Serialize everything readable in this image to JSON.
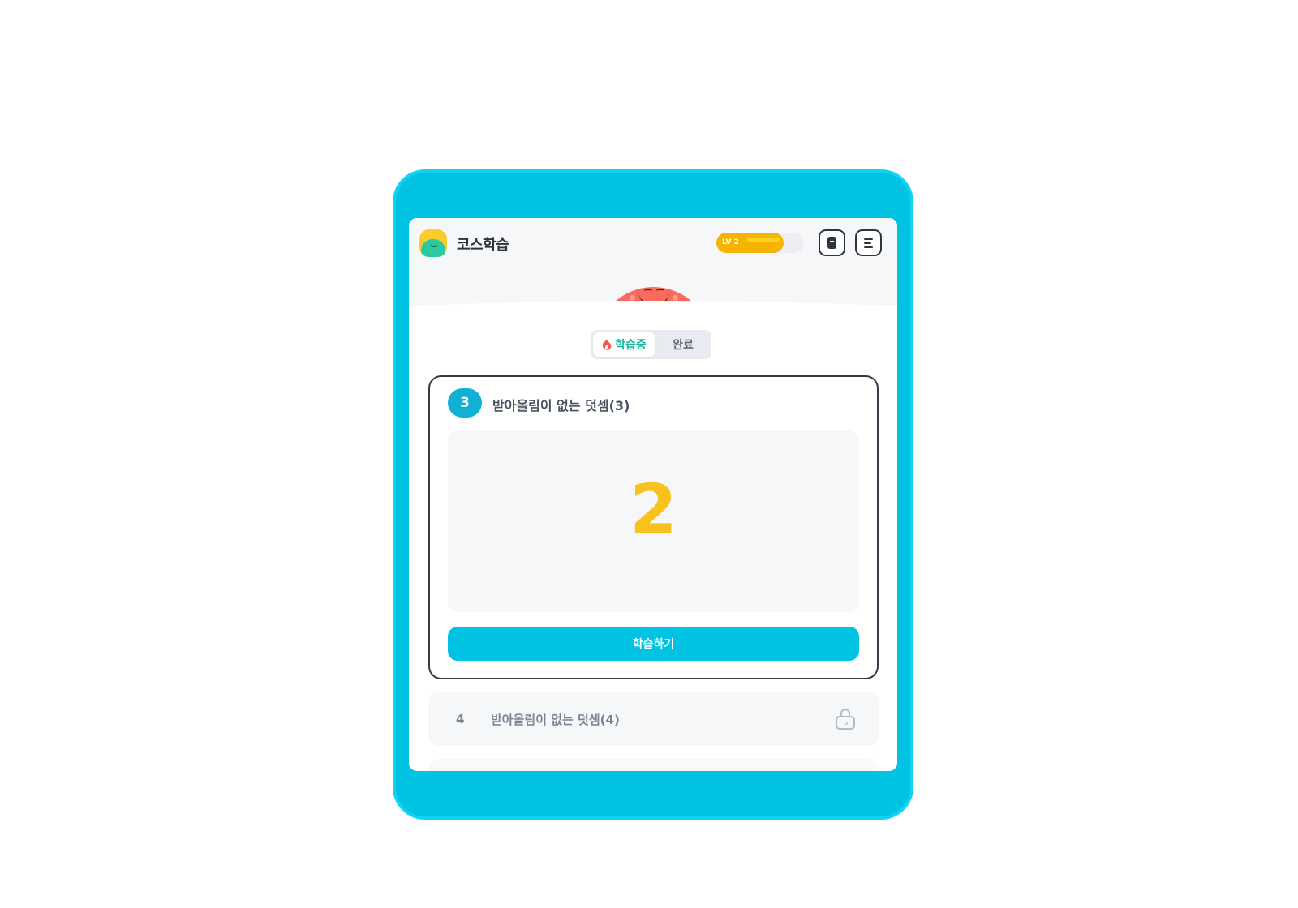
{
  "app": {
    "title": "코스학습"
  },
  "header": {
    "level_label": "LV 2",
    "level_progress": 0.77
  },
  "tabs": [
    {
      "label": "학습중",
      "active": true
    },
    {
      "label": "완료",
      "active": false
    }
  ],
  "current_lesson": {
    "number": "3",
    "title": "받아올림이 없는 덧셈(3)",
    "preview_value": "2",
    "action_label": "학습하기"
  },
  "locked_lessons": [
    {
      "number": "4",
      "title": "받아올림이 없는 덧셈(4)"
    }
  ],
  "icons": {
    "logo": "mascot-logo-icon",
    "book": "book-icon",
    "menu": "menu-icon",
    "flame": "flame-icon",
    "lock": "lock-icon"
  },
  "colors": {
    "frame": "#00c3e3",
    "primary": "#00c3e3",
    "badge": "#11b1d6",
    "active_tab": "#16b8a0",
    "level_bar": "#f6b400",
    "preview_number": "#f7c21c",
    "mascot": "#fa6b5e"
  }
}
